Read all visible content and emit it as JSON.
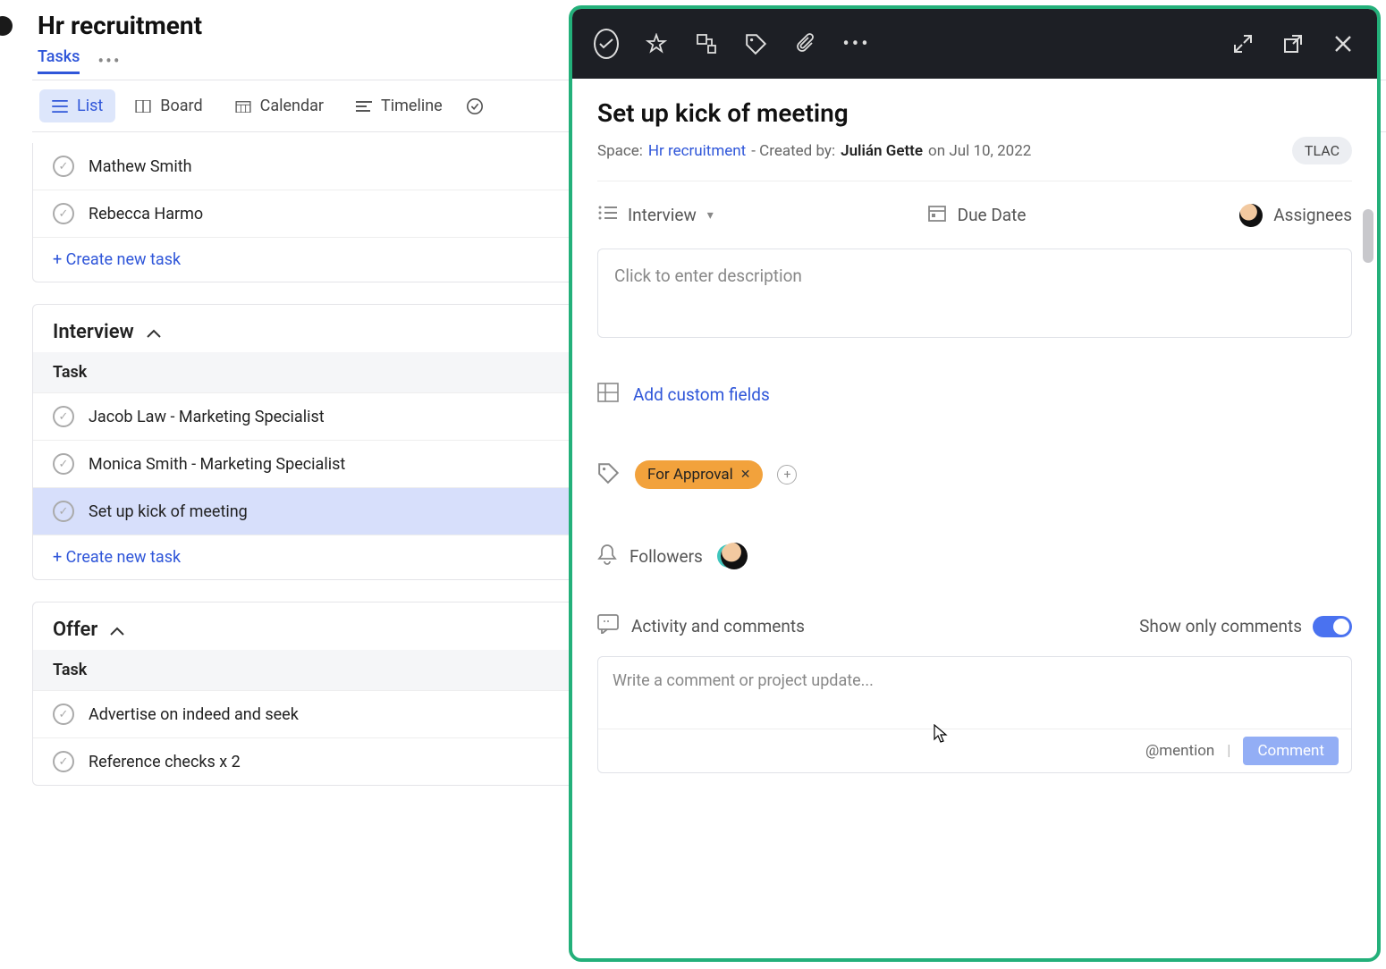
{
  "header": {
    "title": "Hr recruitment",
    "tab_label": "Tasks"
  },
  "views": {
    "list": "List",
    "board": "Board",
    "calendar": "Calendar",
    "timeline": "Timeline"
  },
  "sections": {
    "top_tasks": [
      "Mathew Smith",
      "Rebecca Harmo"
    ],
    "interview": {
      "title": "Interview",
      "col": "Task",
      "tasks": [
        "Jacob Law - Marketing Specialist",
        "Monica Smith - Marketing Specialist",
        "Set up kick of meeting"
      ]
    },
    "offer": {
      "title": "Offer",
      "col": "Task",
      "tasks": [
        "Advertise on indeed and seek",
        "Reference checks x 2"
      ]
    },
    "create": "+ Create new task"
  },
  "panel": {
    "title": "Set up kick of meeting",
    "space_label": "Space:",
    "space_link": "Hr recruitment",
    "created_prefix": "- Created by:",
    "created_by": "Julián Gette",
    "created_on": "on Jul 10, 2022",
    "badge": "TLAC",
    "status": "Interview",
    "due_label": "Due Date",
    "assignees_label": "Assignees",
    "desc_placeholder": "Click to enter description",
    "add_cf": "Add custom fields",
    "tag": "For Approval",
    "followers_label": "Followers",
    "activity_label": "Activity and comments",
    "show_only_label": "Show only comments",
    "comment_placeholder": "Write a comment or project update...",
    "mention": "@mention",
    "comment_btn": "Comment"
  }
}
